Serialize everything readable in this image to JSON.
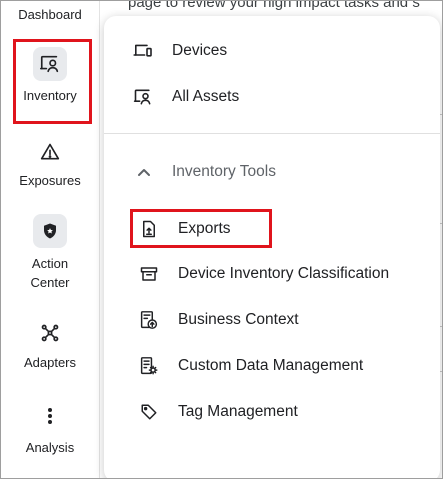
{
  "background_page": {
    "snippet": "page to review your high impact tasks and s"
  },
  "sidebar": {
    "items": [
      {
        "label": "Dashboard",
        "icon": "dashboard-icon"
      },
      {
        "label": "Inventory",
        "icon": "inventory-icon",
        "selected": true
      },
      {
        "label": "Exposures",
        "icon": "warning-icon"
      },
      {
        "label": "Action\nCenter",
        "label_line1": "Action",
        "label_line2": "Center",
        "icon": "shield-icon"
      },
      {
        "label": "Adapters",
        "icon": "adapters-icon"
      },
      {
        "label": "Analysis",
        "icon": "more-vert-icon"
      }
    ]
  },
  "menu": {
    "top_items": [
      {
        "label": "Devices",
        "icon": "devices-icon"
      },
      {
        "label": "All Assets",
        "icon": "all-assets-icon"
      }
    ],
    "section": {
      "label": "Inventory Tools",
      "icon": "chevron-up-icon",
      "expanded": true,
      "items": [
        {
          "label": "Exports",
          "icon": "export-file-icon",
          "highlighted": true
        },
        {
          "label": "Device Inventory Classification",
          "icon": "archive-box-icon"
        },
        {
          "label": "Business Context",
          "icon": "business-context-icon"
        },
        {
          "label": "Custom Data Management",
          "icon": "custom-data-icon"
        },
        {
          "label": "Tag Management",
          "icon": "tag-icon"
        }
      ]
    }
  },
  "colors": {
    "highlight": "#e0141c",
    "text": "#202124",
    "muted_text": "#5f6368",
    "chip_bg": "#e8eaed"
  }
}
